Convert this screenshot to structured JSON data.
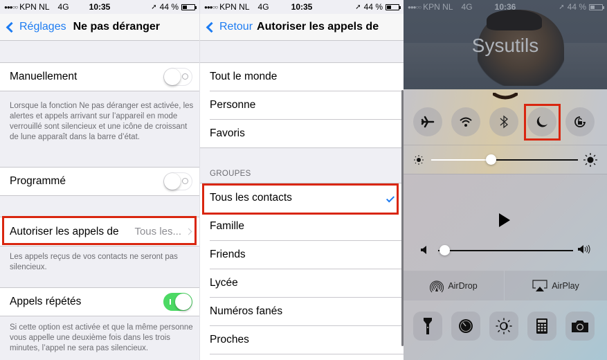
{
  "statusbar": {
    "signal": "●●●○○",
    "carrier": "KPN NL",
    "network": "4G",
    "battery_percent": "44 %",
    "battery_level": 0.44
  },
  "screen1": {
    "time": "10:35",
    "nav": {
      "back_label": "Réglages",
      "title": "Ne pas déranger"
    },
    "manual": {
      "label": "Manuellement",
      "enabled": false
    },
    "manual_footer": "Lorsque la fonction Ne pas déranger est activée, les alertes et appels arrivant sur l’appareil en mode verrouillé sont silencieux et une icône de croissant de lune apparaît dans la barre d’état.",
    "scheduled": {
      "label": "Programmé",
      "enabled": false
    },
    "allow_calls": {
      "label": "Autoriser les appels de",
      "value": "Tous les..."
    },
    "allow_calls_footer": "Les appels reçus de vos contacts ne seront pas silencieux.",
    "repeated": {
      "label": "Appels répétés",
      "enabled": true
    },
    "repeated_footer": "Si cette option est activée et que la même personne vous appelle une deuxième fois dans les trois minutes, l’appel ne sera pas silencieux."
  },
  "screen2": {
    "time": "10:35",
    "nav": {
      "back_label": "Retour",
      "title": "Autoriser les appels de"
    },
    "options": [
      "Tout le monde",
      "Personne",
      "Favoris"
    ],
    "groups_header": "GROUPES",
    "groups": [
      "Tous les contacts",
      "Famille",
      "Friends",
      "Lycée",
      "Numéros fanés",
      "Proches"
    ],
    "selected": "Tous les contacts"
  },
  "screen3": {
    "time": "10:36",
    "lock_title": "Sysutils",
    "toggles": [
      {
        "name": "airplane",
        "icon": "airplane-icon",
        "active": false
      },
      {
        "name": "wifi",
        "icon": "wifi-icon",
        "active": false
      },
      {
        "name": "bluetooth",
        "icon": "bluetooth-icon",
        "active": false
      },
      {
        "name": "do-not-disturb",
        "icon": "moon-icon",
        "active": false
      },
      {
        "name": "rotation-lock",
        "icon": "rotation-lock-icon",
        "active": false
      }
    ],
    "brightness": 0.41,
    "volume": 0.02,
    "airdrop_label": "AirDrop",
    "airplay_label": "AirPlay",
    "shortcuts": [
      {
        "name": "flashlight",
        "icon": "flashlight-icon"
      },
      {
        "name": "timer",
        "icon": "timer-icon"
      },
      {
        "name": "night-shift",
        "icon": "night-shift-icon"
      },
      {
        "name": "calculator",
        "icon": "calculator-icon"
      },
      {
        "name": "camera",
        "icon": "camera-icon"
      }
    ]
  },
  "colors": {
    "accent": "#1d7cf2",
    "toggle_on": "#4cd964",
    "highlight": "#d9260f"
  }
}
